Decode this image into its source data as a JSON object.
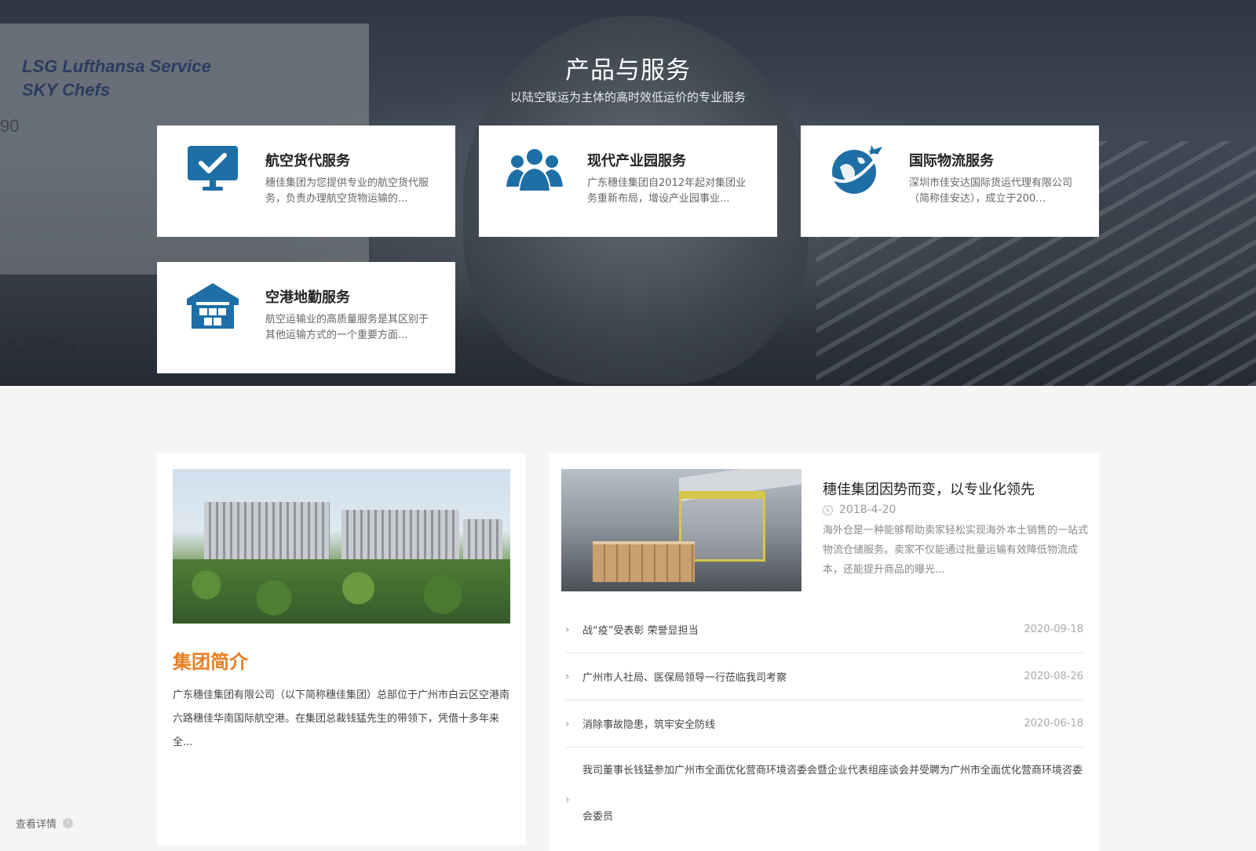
{
  "hero": {
    "title": "产品与服务",
    "subtitle": "以陆空联运为主体的高时效低运价的专业服务",
    "background_text": {
      "truck_line1": "LSG Lufthansa Service",
      "truck_line2": "SKY Chefs",
      "truck_number": "90",
      "code": "KJA0064"
    }
  },
  "services": [
    {
      "name": "航空货代服务",
      "desc": "穗佳集团为您提供专业的航空货代服务，负责办理航空货物运输的...",
      "icon": "monitor-check-icon"
    },
    {
      "name": "现代产业园服务",
      "desc": "广东穗佳集团自2012年起对集团业务重新布局，增设产业园事业...",
      "icon": "users-group-icon"
    },
    {
      "name": "国际物流服务",
      "desc": "深圳市佳安达国际货运代理有限公司（简称佳安达），成立于200...",
      "icon": "globe-plane-icon"
    },
    {
      "name": "空港地勤服务",
      "desc": "航空运输业的高质量服务是其区别于其他运输方式的一个重要方面...",
      "icon": "warehouse-icon"
    }
  ],
  "intro": {
    "title": "集团简介",
    "text": "广东穗佳集团有限公司（以下简称穗佳集团）总部位于广州市白云区空港南六路穗佳华南国际航空港。在集团总裁钱猛先生的带领下，凭借十多年来全...",
    "more_label": "查看详情"
  },
  "news": {
    "featured": {
      "title": "穗佳集团因势而变，以专业化领先",
      "date": "2018-4-20",
      "summary": "海外仓是一种能够帮助卖家轻松实现海外本土销售的一站式物流仓储服务。卖家不仅能通过批量运输有效降低物流成本，还能提升商品的曝光..."
    },
    "items": [
      {
        "title": "战“疫”受表彰 荣誉显担当",
        "date": "2020-09-18"
      },
      {
        "title": "广州市人社局、医保局领导一行莅临我司考察",
        "date": "2020-08-26"
      },
      {
        "title": "消除事故隐患，筑牢安全防线",
        "date": "2020-06-18"
      },
      {
        "title": "我司董事长钱猛参加广州市全面优化营商环境咨委会暨企业代表组座谈会并受聘为广州市全面优化营商环境咨委会委员",
        "date": ""
      }
    ]
  },
  "colors": {
    "accent_orange": "#e87e22",
    "icon_blue": "#1e6fa6",
    "card_bg": "#ffffff",
    "page_bg": "#f5f5f5"
  }
}
